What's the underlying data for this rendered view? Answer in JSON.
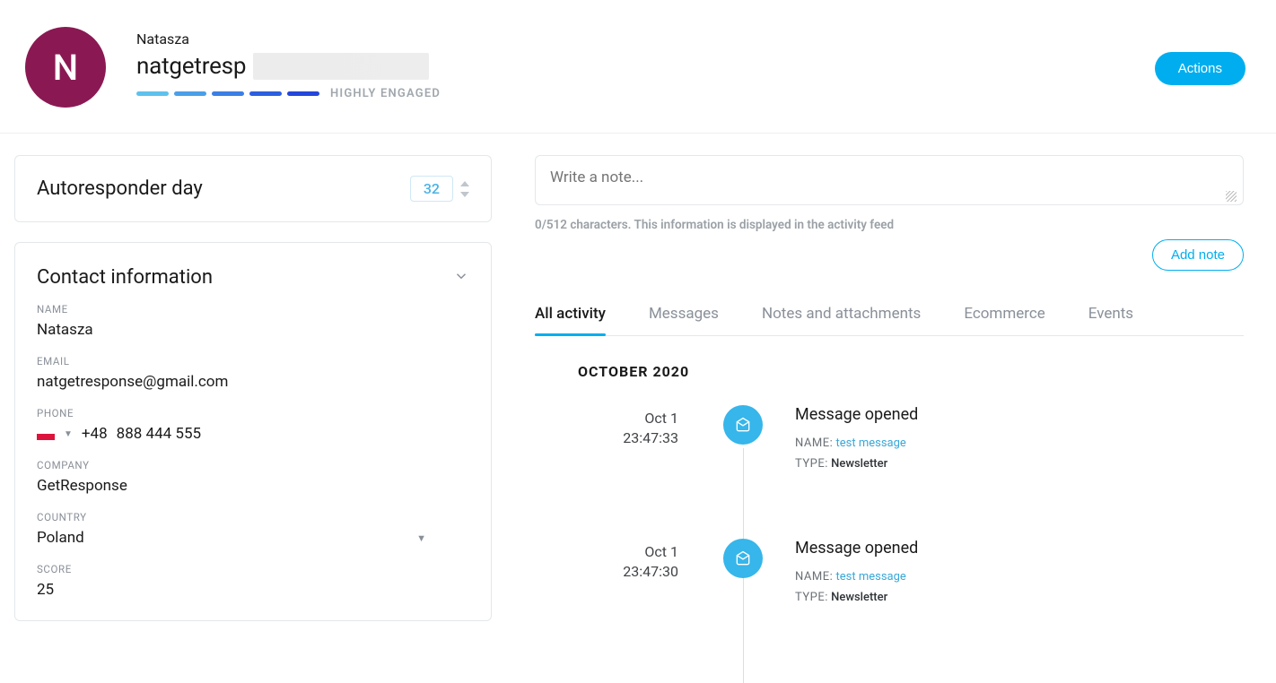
{
  "header": {
    "avatar_initial": "N",
    "name": "Natasza",
    "email_display": "natgetresp",
    "engagement_label": "HIGHLY ENGAGED",
    "actions_label": "Actions"
  },
  "autoresponder": {
    "label": "Autoresponder day",
    "value": "32"
  },
  "contact": {
    "section_title": "Contact information",
    "name_label": "NAME",
    "name_value": "Natasza",
    "email_label": "EMAIL",
    "email_value": "natgetresponse@gmail.com",
    "phone_label": "PHONE",
    "phone_prefix": "+48",
    "phone_number": "888 444 555",
    "company_label": "COMPANY",
    "company_value": "GetResponse",
    "country_label": "COUNTRY",
    "country_value": "Poland",
    "score_label": "SCORE",
    "score_value": "25"
  },
  "notes": {
    "placeholder": "Write a note...",
    "counter_text": "0/512 characters. This information is displayed in the activity feed",
    "add_button": "Add note"
  },
  "tabs": {
    "items": [
      {
        "label": "All activity",
        "active": true
      },
      {
        "label": "Messages",
        "active": false
      },
      {
        "label": "Notes and attachments",
        "active": false
      },
      {
        "label": "Ecommerce",
        "active": false
      },
      {
        "label": "Events",
        "active": false
      }
    ]
  },
  "timeline": {
    "month": "OCTOBER 2020",
    "events": [
      {
        "date": "Oct 1",
        "time": "23:47:33",
        "title": "Message opened",
        "name_label": "NAME:",
        "name_value": "test message",
        "type_label": "TYPE:",
        "type_value": "Newsletter"
      },
      {
        "date": "Oct 1",
        "time": "23:47:30",
        "title": "Message opened",
        "name_label": "NAME:",
        "name_value": "test message",
        "type_label": "TYPE:",
        "type_value": "Newsletter"
      }
    ]
  }
}
